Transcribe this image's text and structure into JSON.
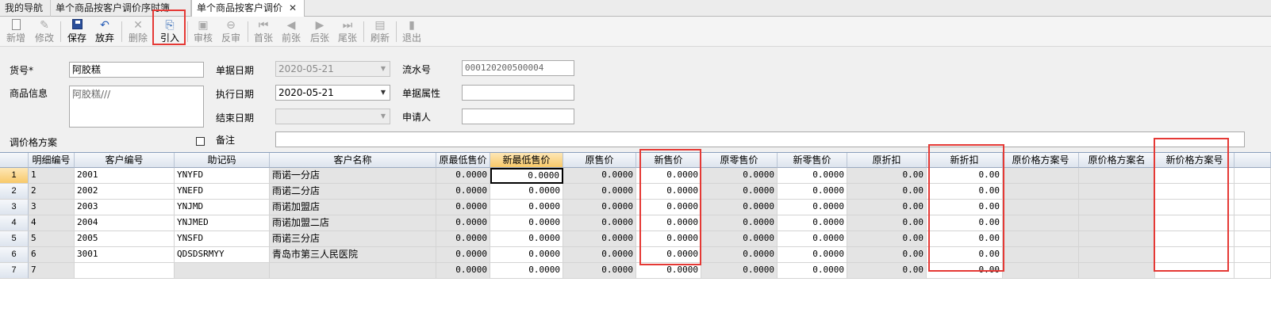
{
  "tabs": [
    {
      "label": "我的导航"
    },
    {
      "label": "单个商品按客户调价序时簿"
    },
    {
      "label": "单个商品按客户调价",
      "close": "✕"
    }
  ],
  "toolbar": {
    "items": [
      {
        "label": "新增",
        "icon": "new-doc-icon"
      },
      {
        "label": "修改",
        "icon": "edit-icon"
      },
      {
        "label": "保存",
        "icon": "save-icon"
      },
      {
        "label": "放弃",
        "icon": "undo-icon"
      },
      {
        "label": "删除",
        "icon": "delete-icon"
      },
      {
        "label": "引入",
        "icon": "import-icon"
      },
      {
        "label": "审核",
        "icon": "audit-icon"
      },
      {
        "label": "反审",
        "icon": "unaudit-icon"
      },
      {
        "label": "首张",
        "icon": "first-icon"
      },
      {
        "label": "前张",
        "icon": "prev-icon"
      },
      {
        "label": "后张",
        "icon": "next-icon"
      },
      {
        "label": "尾张",
        "icon": "last-icon"
      },
      {
        "label": "刷新",
        "icon": "refresh-icon"
      },
      {
        "label": "退出",
        "icon": "exit-icon"
      }
    ]
  },
  "form": {
    "item_no_label": "货号*",
    "item_no_value": "阿胶糕",
    "item_info_label": "商品信息",
    "item_info_value": "阿胶糕///",
    "price_scheme_label": "调价格方案",
    "doc_date_label": "单据日期",
    "doc_date_value": "2020-05-21",
    "exec_date_label": "执行日期",
    "exec_date_value": "2020-05-21",
    "end_date_label": "结束日期",
    "end_date_value": "",
    "serial_label": "流水号",
    "serial_value": "000120200500004",
    "doc_attr_label": "单据属性",
    "doc_attr_value": "",
    "applicant_label": "申请人",
    "applicant_value": "",
    "remark_label": "备注",
    "remark_value": ""
  },
  "grid": {
    "columns": [
      "明细编号",
      "客户编号",
      "助记码",
      "客户名称",
      "原最低售价",
      "新最低售价",
      "原售价",
      "新售价",
      "原零售价",
      "新零售价",
      "原折扣",
      "新折扣",
      "原价格方案号",
      "原价格方案名",
      "新价格方案号"
    ],
    "rows": [
      {
        "rn": "1",
        "id": "1",
        "cust_no": "2001",
        "mnemonic": "YNYFD",
        "name": "雨诺一分店",
        "old_min": "0.0000",
        "new_min": "0.0000",
        "old_price": "0.0000",
        "new_price": "0.0000",
        "old_retail": "0.0000",
        "new_retail": "0.0000",
        "old_disc": "0.00",
        "new_disc": "0.00"
      },
      {
        "rn": "2",
        "id": "2",
        "cust_no": "2002",
        "mnemonic": "YNEFD",
        "name": "雨诺二分店",
        "old_min": "0.0000",
        "new_min": "0.0000",
        "old_price": "0.0000",
        "new_price": "0.0000",
        "old_retail": "0.0000",
        "new_retail": "0.0000",
        "old_disc": "0.00",
        "new_disc": "0.00"
      },
      {
        "rn": "3",
        "id": "3",
        "cust_no": "2003",
        "mnemonic": "YNJMD",
        "name": "雨诺加盟店",
        "old_min": "0.0000",
        "new_min": "0.0000",
        "old_price": "0.0000",
        "new_price": "0.0000",
        "old_retail": "0.0000",
        "new_retail": "0.0000",
        "old_disc": "0.00",
        "new_disc": "0.00"
      },
      {
        "rn": "4",
        "id": "4",
        "cust_no": "2004",
        "mnemonic": "YNJMED",
        "name": "雨诺加盟二店",
        "old_min": "0.0000",
        "new_min": "0.0000",
        "old_price": "0.0000",
        "new_price": "0.0000",
        "old_retail": "0.0000",
        "new_retail": "0.0000",
        "old_disc": "0.00",
        "new_disc": "0.00"
      },
      {
        "rn": "5",
        "id": "5",
        "cust_no": "2005",
        "mnemonic": "YNSFD",
        "name": "雨诺三分店",
        "old_min": "0.0000",
        "new_min": "0.0000",
        "old_price": "0.0000",
        "new_price": "0.0000",
        "old_retail": "0.0000",
        "new_retail": "0.0000",
        "old_disc": "0.00",
        "new_disc": "0.00"
      },
      {
        "rn": "6",
        "id": "6",
        "cust_no": "3001",
        "mnemonic": "QDSDSRMYY",
        "name": "青岛市第三人民医院",
        "old_min": "0.0000",
        "new_min": "0.0000",
        "old_price": "0.0000",
        "new_price": "0.0000",
        "old_retail": "0.0000",
        "new_retail": "0.0000",
        "old_disc": "0.00",
        "new_disc": "0.00"
      },
      {
        "rn": "7",
        "id": "7",
        "cust_no": "",
        "mnemonic": "",
        "name": "",
        "old_min": "0.0000",
        "new_min": "0.0000",
        "old_price": "0.0000",
        "new_price": "0.0000",
        "old_retail": "0.0000",
        "new_retail": "0.0000",
        "old_disc": "0.00",
        "new_disc": "0.00"
      }
    ]
  },
  "colors": {
    "highlight_box": "#e53935",
    "active_header": "#f8c96a",
    "readonly_cell": "#e4e4e4"
  }
}
